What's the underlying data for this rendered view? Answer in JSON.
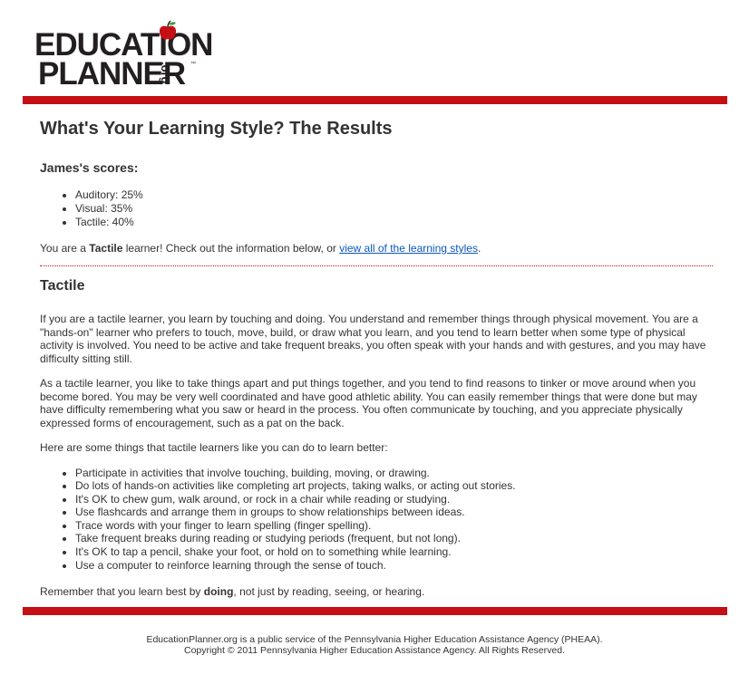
{
  "logo": {
    "line1": "EDUCATION",
    "line2": "PLANNER",
    "suffix": ".org",
    "tm": "™"
  },
  "page_title": "What's Your Learning Style? The Results",
  "scores": {
    "heading": "James's scores:",
    "items": [
      "Auditory: 25%",
      "Visual: 35%",
      "Tactile: 40%"
    ]
  },
  "result": {
    "prefix": "You are a ",
    "style": "Tactile",
    "middle": " learner! Check out the information below, or ",
    "link": "view all of the learning styles",
    "suffix": "."
  },
  "section": {
    "heading": "Tactile",
    "paragraphs": [
      "If you are a tactile learner, you learn by touching and doing. You understand and remember things through physical movement. You are a \"hands-on\" learner who prefers to touch, move, build, or draw what you learn, and you tend to learn better when some type of physical activity is involved. You need to be active and take frequent breaks, you often speak with your hands and with gestures, and you may have difficulty sitting still.",
      "As a tactile learner, you like to take things apart and put things together, and you tend to find reasons to tinker or move around when you become bored. You may be very well coordinated and have good athletic ability. You can easily remember things that were done but may have difficulty remembering what you saw or heard in the process. You often communicate by touching, and you appreciate physically expressed forms of encouragement, such as a pat on the back.",
      "Here are some things that tactile learners like you can do to learn better:"
    ],
    "tips": [
      "Participate in activities that involve touching, building, moving, or drawing.",
      "Do lots of hands-on activities like completing art projects, taking walks, or acting out stories.",
      "It's OK to chew gum, walk around, or rock in a chair while reading or studying.",
      "Use flashcards and arrange them in groups to show relationships between ideas.",
      "Trace words with your finger to learn spelling (finger spelling).",
      "Take frequent breaks during reading or studying periods (frequent, but not long).",
      "It's OK to tap a pencil, shake your foot, or hold on to something while learning.",
      "Use a computer to reinforce learning through the sense of touch."
    ],
    "closing": {
      "prefix": "Remember that you learn best by ",
      "emphasis": "doing",
      "suffix": ", not just by reading, seeing, or hearing."
    }
  },
  "footer": {
    "line1": "EducationPlanner.org is a public service of the Pennsylvania Higher Education Assistance Agency (PHEAA).",
    "line2": "Copyright © 2011 Pennsylvania Higher Education Assistance Agency. All Rights Reserved."
  },
  "colors": {
    "brand_red": "#c40f14",
    "link_blue": "#0b57c0",
    "text": "#333333",
    "apple_green": "#3a9a2f"
  }
}
